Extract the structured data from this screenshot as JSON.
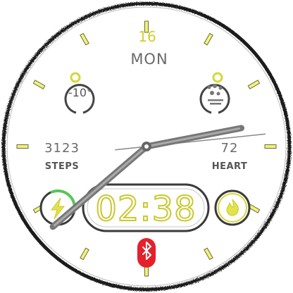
{
  "colors": {
    "accent": "#e8e84a",
    "ring": "#2a2a2a",
    "progress": "#58c558",
    "bluetooth": "#e4212b",
    "hand": "#777777"
  },
  "date": {
    "day": "16",
    "weekday": "MON"
  },
  "weather": {
    "temperature": "-10°",
    "icon": "cloud-icon"
  },
  "steps": {
    "value": "3123",
    "label": "STEPS",
    "icon": "lightning-icon"
  },
  "heart": {
    "value": "72",
    "label": "HEART",
    "icon": "flame-icon"
  },
  "clock": {
    "digital_time": "02:38",
    "hour": 2,
    "minute": 38,
    "second": 14
  },
  "bluetooth": {
    "icon": "bluetooth-icon",
    "connected": true
  },
  "steps_progress": 0.3
}
